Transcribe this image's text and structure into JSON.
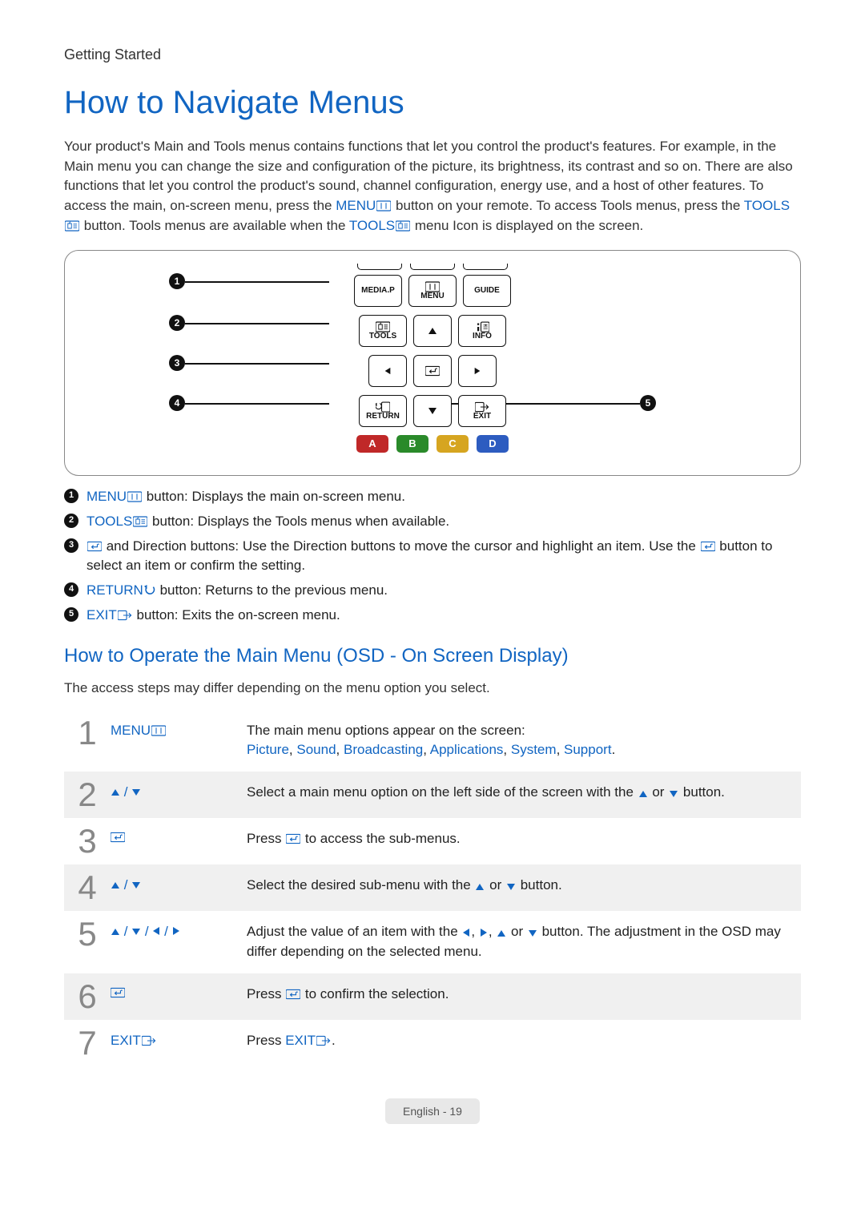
{
  "header": {
    "section": "Getting Started"
  },
  "title": "How to Navigate Menus",
  "intro": {
    "p1a": "Your product's Main and Tools menus contains functions that let you control the product's features. For example, in the Main menu you can change the size and configuration of the picture, its brightness, its contrast and so on. There are also functions that let you control the product's sound, channel configuration, energy use, and a host of other features. To access the main, on-screen menu, press the ",
    "menu": "MENU",
    "p1b": " button on your remote. To access Tools menus, press the ",
    "tools": "TOOLS",
    "p1c": " button. Tools menus are available when the ",
    "p1d": " menu Icon is displayed on the screen."
  },
  "remote": {
    "mediap": "MEDIA.P",
    "menu": "MENU",
    "guide": "GUIDE",
    "tools": "TOOLS",
    "info": "INFO",
    "return": "RETURN",
    "exit": "EXIT",
    "a": "A",
    "b": "B",
    "c": "C",
    "d": "D",
    "callouts": {
      "c1": "1",
      "c2": "2",
      "c3": "3",
      "c4": "4",
      "c5": "5"
    }
  },
  "legend": {
    "l1": {
      "key": "MENU",
      "text": " button: Displays the main on-screen menu."
    },
    "l2": {
      "key": "TOOLS",
      "text": " button: Displays the Tools menus when available."
    },
    "l3": {
      "pre": " and Direction buttons: Use the Direction buttons to move the cursor and highlight an item. Use the ",
      "post": " button to select an item or confirm the setting."
    },
    "l4": {
      "key": "RETURN",
      "text": " button: Returns to the previous menu."
    },
    "l5": {
      "key": "EXIT",
      "text": " button: Exits the on-screen menu."
    }
  },
  "osd": {
    "heading": "How to Operate the Main Menu (OSD - On Screen Display)",
    "note": "The access steps may differ depending on the menu option you select.",
    "steps": {
      "s1": {
        "num": "1",
        "key": "MENU",
        "d1": "The main menu options appear on the screen:",
        "opts": {
          "a": "Picture",
          "b": "Sound",
          "c": "Broadcasting",
          "d": "Applications",
          "e": "System",
          "f": "Support"
        }
      },
      "s2": {
        "num": "2",
        "d1": "Select a main menu option on the left side of the screen with the ",
        "d2": " or ",
        "d3": " button."
      },
      "s3": {
        "num": "3",
        "d1": "Press ",
        "d2": " to access the sub-menus."
      },
      "s4": {
        "num": "4",
        "d1": "Select the desired sub-menu with the ",
        "d2": " or ",
        "d3": " button."
      },
      "s5": {
        "num": "5",
        "d1": "Adjust the value of an item with the ",
        "d2": " or ",
        "d3": " button. The adjustment in the OSD may differ depending on the selected menu."
      },
      "s6": {
        "num": "6",
        "d1": "Press ",
        "d2": " to confirm the selection."
      },
      "s7": {
        "num": "7",
        "key": "EXIT",
        "d1": "Press ",
        "d2": "EXIT",
        "d3": "."
      }
    }
  },
  "footer": {
    "text": "English - 19"
  }
}
